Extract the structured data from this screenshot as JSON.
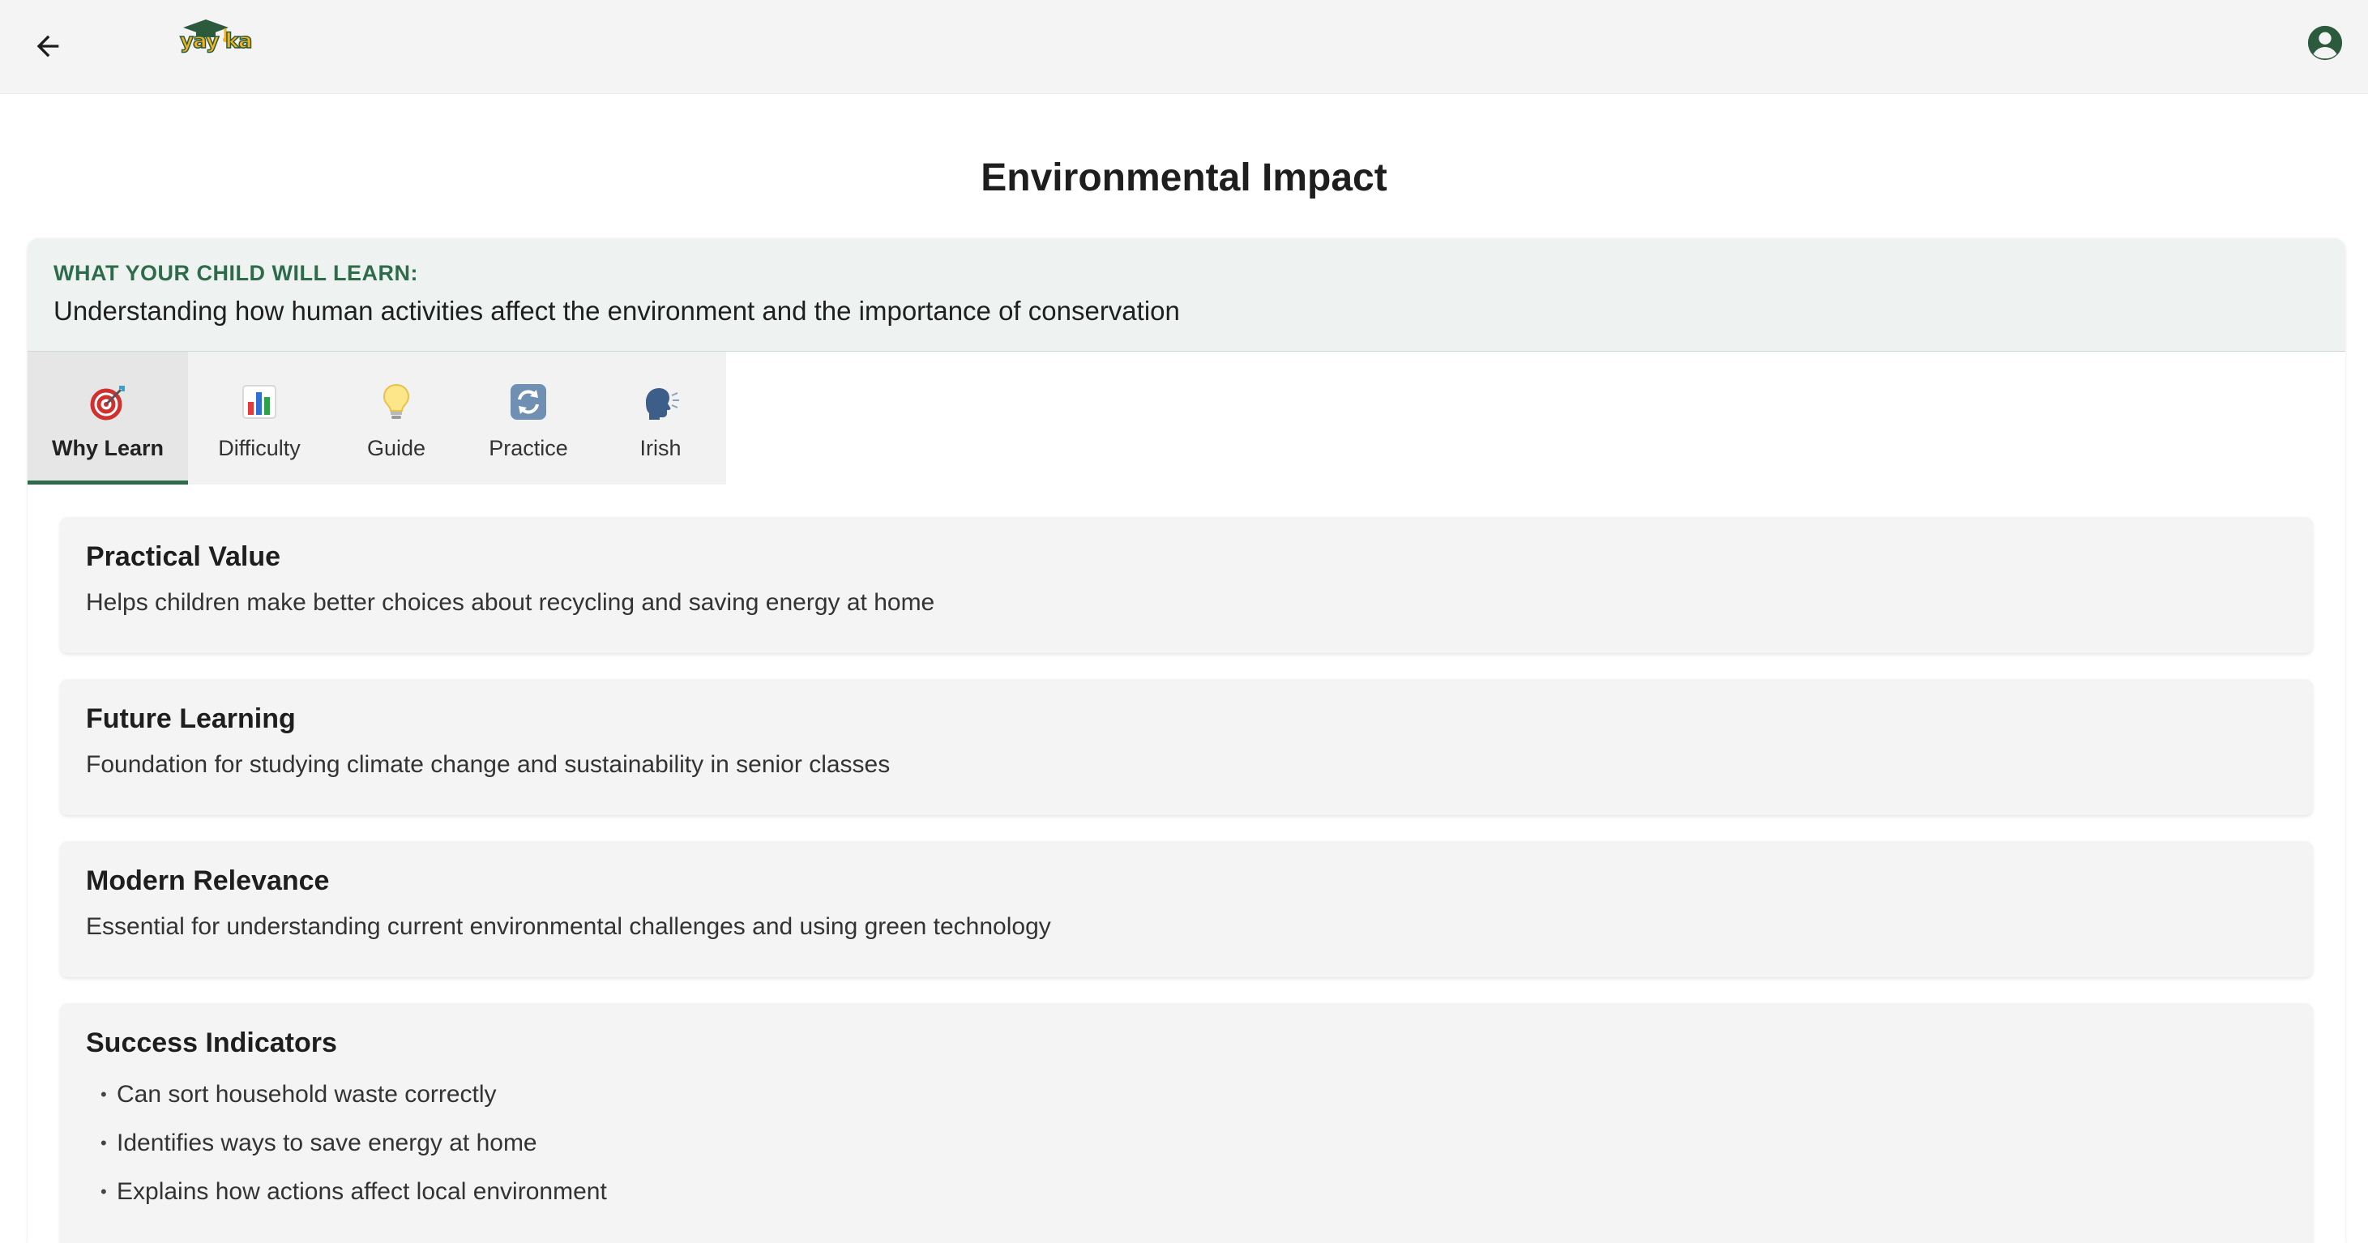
{
  "header": {
    "back_icon": "arrow-left-icon",
    "logo_text": "yay ka",
    "profile_icon": "user-circle-icon"
  },
  "page": {
    "title": "Environmental Impact"
  },
  "objective": {
    "label": "WHAT YOUR CHILD WILL LEARN:",
    "text": "Understanding how human activities affect the environment and the importance of conservation"
  },
  "tabs": [
    {
      "label": "Why Learn",
      "icon": "target-icon",
      "active": true
    },
    {
      "label": "Difficulty",
      "icon": "bar-chart-icon",
      "active": false
    },
    {
      "label": "Guide",
      "icon": "lightbulb-icon",
      "active": false
    },
    {
      "label": "Practice",
      "icon": "repeat-icon",
      "active": false
    },
    {
      "label": "Irish",
      "icon": "speaking-head-icon",
      "active": false
    }
  ],
  "cards": [
    {
      "title": "Practical Value",
      "text": "Helps children make better choices about recycling and saving energy at home"
    },
    {
      "title": "Future Learning",
      "text": "Foundation for studying climate change and sustainability in senior classes"
    },
    {
      "title": "Modern Relevance",
      "text": "Essential for understanding current environmental challenges and using green technology"
    }
  ],
  "success": {
    "title": "Success Indicators",
    "items": [
      "Can sort household waste correctly",
      "Identifies ways to save energy at home",
      "Explains how actions affect local environment"
    ]
  },
  "colors": {
    "accent": "#2e6b4a",
    "topbar_bg": "#f4f4f4",
    "card_bg": "#f4f4f4"
  }
}
